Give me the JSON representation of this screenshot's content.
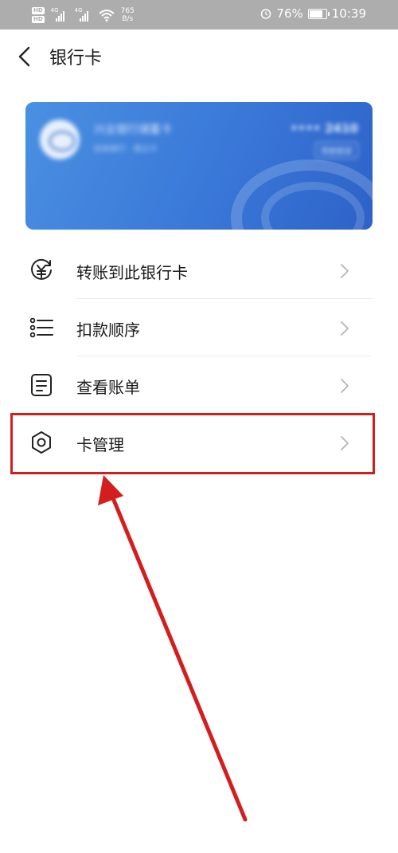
{
  "status_bar": {
    "hd_badge": "HD",
    "network_type": "4G",
    "speed_value": "765",
    "speed_unit": "B/s",
    "battery": "76%",
    "time": "10:39",
    "battery_level": 0.76
  },
  "header": {
    "title": "银行卡"
  },
  "card": {
    "bank_name": "兴业银行储蓄卡",
    "subtitle": "招商银行 · 借记卡",
    "number_masked": "•••• 2410",
    "tag": "限额额度"
  },
  "menu": {
    "items": [
      {
        "label": "转账到此银行卡",
        "icon": "transfer-yuan-icon"
      },
      {
        "label": "扣款顺序",
        "icon": "list-icon"
      },
      {
        "label": "查看账单",
        "icon": "bill-icon"
      },
      {
        "label": "卡管理",
        "icon": "gear-icon"
      }
    ]
  },
  "colors": {
    "status_bar": "#adadad",
    "card_blue": "#3a78d8",
    "annotation_red": "#d41e1e"
  }
}
